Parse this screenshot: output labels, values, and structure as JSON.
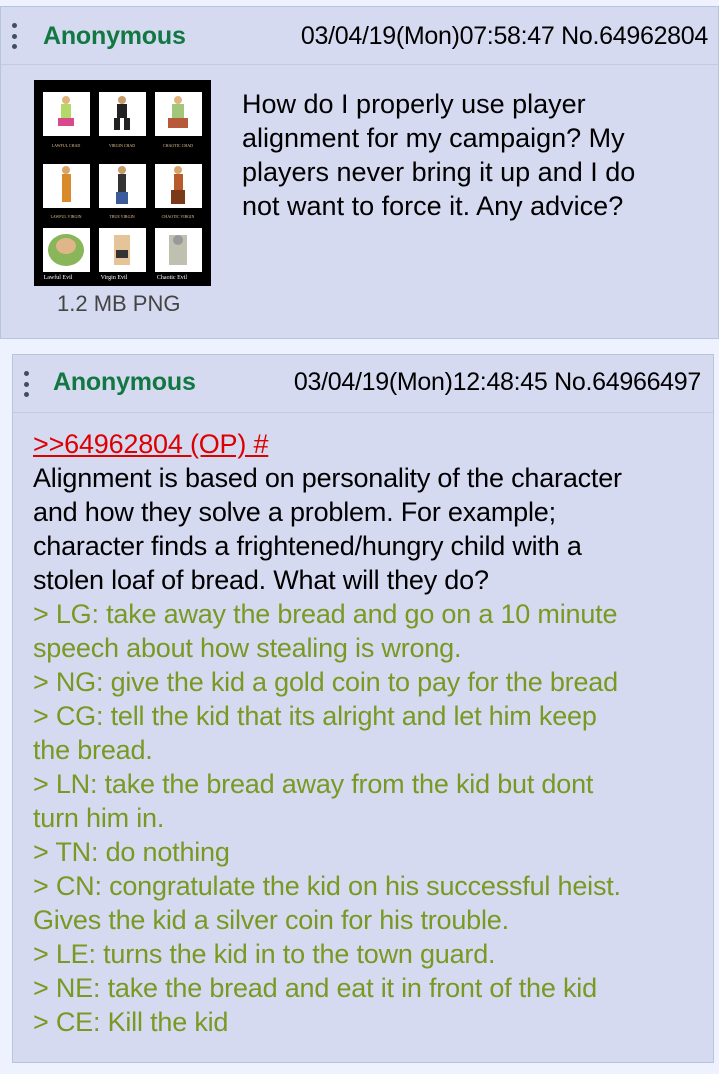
{
  "op": {
    "name": "Anonymous",
    "meta": "03/04/19(Mon)07:58:47 No.64962804",
    "file_info": "1.2 MB PNG",
    "thumbnail_labels": {
      "row1": [
        "LAWFUL CHAD",
        "VIRGIN CHAD",
        "CHAOTIC CHAD"
      ],
      "row2": [
        "LAWFUL VIRGIN",
        "TRUE VIRGIN",
        "CHAOTIC VIRGIN"
      ],
      "row3": [
        "Lawful Evil",
        "Virgin Evil",
        "Chaotic Evil"
      ]
    },
    "text_lines": [
      "How do I properly use player",
      "alignment for my campaign? My",
      "players never bring it up and I do",
      "not want to force it. Any advice?"
    ]
  },
  "reply": {
    "name": "Anonymous",
    "meta": "03/04/19(Mon)12:48:45 No.64966497",
    "quote_link": ">>64962804 (OP) #",
    "text_lines": [
      "Alignment is based on personality of the character",
      "and how they solve a problem. For example;",
      "character finds a frightened/hungry child with a",
      "stolen loaf of bread. What will they do?"
    ],
    "greentext_lines": [
      "> LG: take away the bread and go on a 10 minute",
      "speech about how stealing is wrong.",
      "> NG: give the kid a gold coin to pay for the bread",
      "> CG: tell the kid that its alright and let him keep",
      "the bread.",
      "> LN: take the bread away from the kid but dont",
      "turn him in.",
      "> TN: do nothing",
      "> CN: congratulate the kid on his successful heist.",
      "Gives the kid a silver coin for his trouble.",
      "> LE: turns the kid in to the town guard.",
      "> NE: take the bread and eat it in front of the kid",
      "> CE: Kill the kid"
    ]
  },
  "colors": {
    "page_bg": "#eef2ff",
    "post_bg": "#d6daf0",
    "name": "#117743",
    "quotelink": "#dd0000",
    "greentext": "#789922"
  }
}
